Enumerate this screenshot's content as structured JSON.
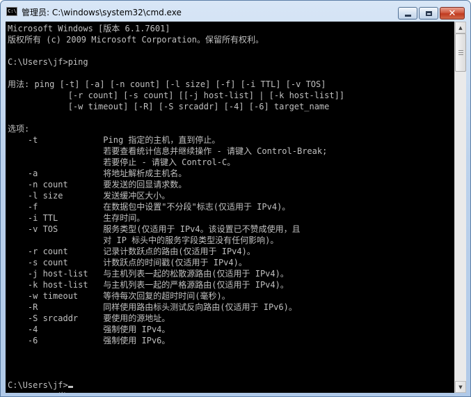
{
  "window": {
    "title": "管理员: C:\\windows\\system32\\cmd.exe",
    "icon": "cmd-icon",
    "controls": {
      "minimize": "minimize-icon",
      "maximize": "maximize-icon",
      "close": "close-icon",
      "close_glyph": "✕"
    }
  },
  "console": {
    "lines": [
      "Microsoft Windows [版本 6.1.7601]",
      "版权所有 (c) 2009 Microsoft Corporation。保留所有权利。",
      "",
      "C:\\Users\\jf>ping",
      "",
      "用法: ping [-t] [-a] [-n count] [-l size] [-f] [-i TTL] [-v TOS]",
      "            [-r count] [-s count] [[-j host-list] | [-k host-list]]",
      "            [-w timeout] [-R] [-S srcaddr] [-4] [-6] target_name",
      "",
      "选项:",
      "    -t             Ping 指定的主机，直到停止。",
      "                   若要查看统计信息并继续操作 - 请键入 Control-Break;",
      "                   若要停止 - 请键入 Control-C。",
      "    -a             将地址解析成主机名。",
      "    -n count       要发送的回显请求数。",
      "    -l size        发送缓冲区大小。",
      "    -f             在数据包中设置\"不分段\"标志(仅适用于 IPv4)。",
      "    -i TTL         生存时间。",
      "    -v TOS         服务类型(仅适用于 IPv4。该设置已不赞成使用，且",
      "                   对 IP 标头中的服务字段类型没有任何影响)。",
      "    -r count       记录计数跃点的路由(仅适用于 IPv4)。",
      "    -s count       计数跃点的时间戳(仅适用于 IPv4)。",
      "    -j host-list   与主机列表一起的松散源路由(仅适用于 IPv4)。",
      "    -k host-list   与主机列表一起的严格源路由(仅适用于 IPv4)。",
      "    -w timeout     等待每次回复的超时时间(毫秒)。",
      "    -R             同样使用路由标头测试反向路由(仅适用于 IPv6)。",
      "    -S srcaddr     要使用的源地址。",
      "    -4             强制使用 IPv4。",
      "    -6             强制使用 IPv6。",
      "",
      "",
      "",
      "C:\\Users\\jf>",
      "          半:"
    ],
    "cursor_line": 32,
    "text_color": "#c0c0c0",
    "background_color": "#000000"
  },
  "scrollbar": {
    "up_arrow": "scroll-up-arrow-icon",
    "down_arrow": "scroll-down-arrow-icon",
    "up_glyph": "▲",
    "down_glyph": "▼"
  }
}
